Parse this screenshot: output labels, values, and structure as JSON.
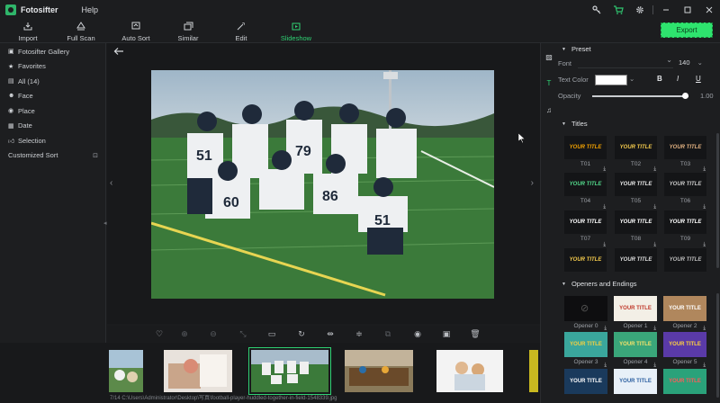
{
  "titlebar": {
    "app_name": "Fotosifter",
    "menu": [
      "Help"
    ],
    "icons": [
      "key-icon",
      "cart-icon",
      "gear-icon"
    ],
    "window_controls": [
      "minimize-icon",
      "maximize-icon",
      "close-icon"
    ]
  },
  "toolbar": {
    "tools": [
      {
        "name": "import",
        "label": "Import",
        "icon": "download-tray-icon"
      },
      {
        "name": "full-scan",
        "label": "Full Scan",
        "icon": "scan-icon"
      },
      {
        "name": "auto-sort",
        "label": "Auto Sort",
        "icon": "sort-icon"
      },
      {
        "name": "similar",
        "label": "Similar",
        "icon": "similar-icon"
      },
      {
        "name": "edit",
        "label": "Edit",
        "icon": "magic-wand-icon"
      },
      {
        "name": "slideshow",
        "label": "Slideshow",
        "icon": "slideshow-icon",
        "active": true
      }
    ],
    "export_label": "Export",
    "accent": "#2fd173"
  },
  "sidebar": {
    "items": [
      {
        "label": "Fotosifter Gallery",
        "icon": "gallery-icon"
      },
      {
        "label": "Favorites",
        "icon": "star-icon"
      },
      {
        "label": "All (14)",
        "icon": "image-icon"
      },
      {
        "label": "Face",
        "icon": "people-icon"
      },
      {
        "label": "Place",
        "icon": "map-pin-icon"
      },
      {
        "label": "Date",
        "icon": "calendar-icon"
      },
      {
        "label": "Selection",
        "icon": "thumbs-up-icon"
      }
    ],
    "custom_sort_label": "Customized Sort"
  },
  "statusbar": {
    "path": "7/14  C:\\Users\\Administrator\\Desktop\\写真\\football-player-huddled-together-in-field-1548339.jpg"
  },
  "panel": {
    "preset_label": "Preset",
    "font_label": "Font",
    "font_size": "140",
    "text_color_label": "Text Color",
    "text_color_value": "#ffffff",
    "format_buttons": [
      "B",
      "I",
      "U"
    ],
    "opacity_label": "Opacity",
    "opacity_value": "1.00",
    "opacity_level": 0.97,
    "titles_label": "Titles",
    "titles": [
      {
        "label": "T01",
        "text": "YOUR TITLE",
        "color": "#f0a000"
      },
      {
        "label": "T02",
        "text": "YOUR TITLE",
        "color": "#f2c94c"
      },
      {
        "label": "T03",
        "text": "YOUR TITLE",
        "color": "#e0b080"
      },
      {
        "label": "T04",
        "text": "YOUR TITLE",
        "color": "#52d88a"
      },
      {
        "label": "T05",
        "text": "YOUR TITLE",
        "color": "#e8e8e8"
      },
      {
        "label": "T06",
        "text": "YOUR TITLE",
        "color": "#c8c8c8"
      },
      {
        "label": "T07",
        "text": "YOUR TITLE",
        "color": "#ffffff"
      },
      {
        "label": "T08",
        "text": "YOUR TITLE",
        "color": "#ffffff"
      },
      {
        "label": "T09",
        "text": "YOUR TITLE",
        "color": "#ffffff"
      },
      {
        "label": "",
        "text": "YOUR TITLE",
        "color": "#f2c94c"
      },
      {
        "label": "",
        "text": "YOUR TITLE",
        "color": "#dddddd"
      },
      {
        "label": "",
        "text": "YOUR TITLE",
        "color": "#bbbbbb"
      }
    ],
    "openers_label": "Openers and Endings",
    "openers": [
      {
        "label": "Opener 0",
        "text": "",
        "bg": "#0e0e10",
        "color": "#555"
      },
      {
        "label": "Opener 1",
        "text": "YOUR TITLE",
        "bg": "#f3efe6",
        "color": "#c0392b"
      },
      {
        "label": "Opener 2",
        "text": "YOUR TITLE",
        "bg": "#b0875d",
        "color": "#ffffff"
      },
      {
        "label": "Opener 3",
        "text": "YOUR TITLE",
        "bg": "#3aa69c",
        "color": "#f5d040"
      },
      {
        "label": "Opener 4",
        "text": "YOUR TITLE",
        "bg": "#3aa67a",
        "color": "#f5e26a"
      },
      {
        "label": "Opener 5",
        "text": "YOUR TITLE",
        "bg": "#5a3aa8",
        "color": "#ffd23f"
      },
      {
        "label": "",
        "text": "YOUR TITLE",
        "bg": "#1a3a5c",
        "color": "#ffffff"
      },
      {
        "label": "",
        "text": "YOUR TITLE",
        "bg": "#e8f0f8",
        "color": "#2b5fa0"
      },
      {
        "label": "",
        "text": "YOUR TITLE",
        "bg": "#2aa27a",
        "color": "#ff5a5a"
      }
    ]
  }
}
